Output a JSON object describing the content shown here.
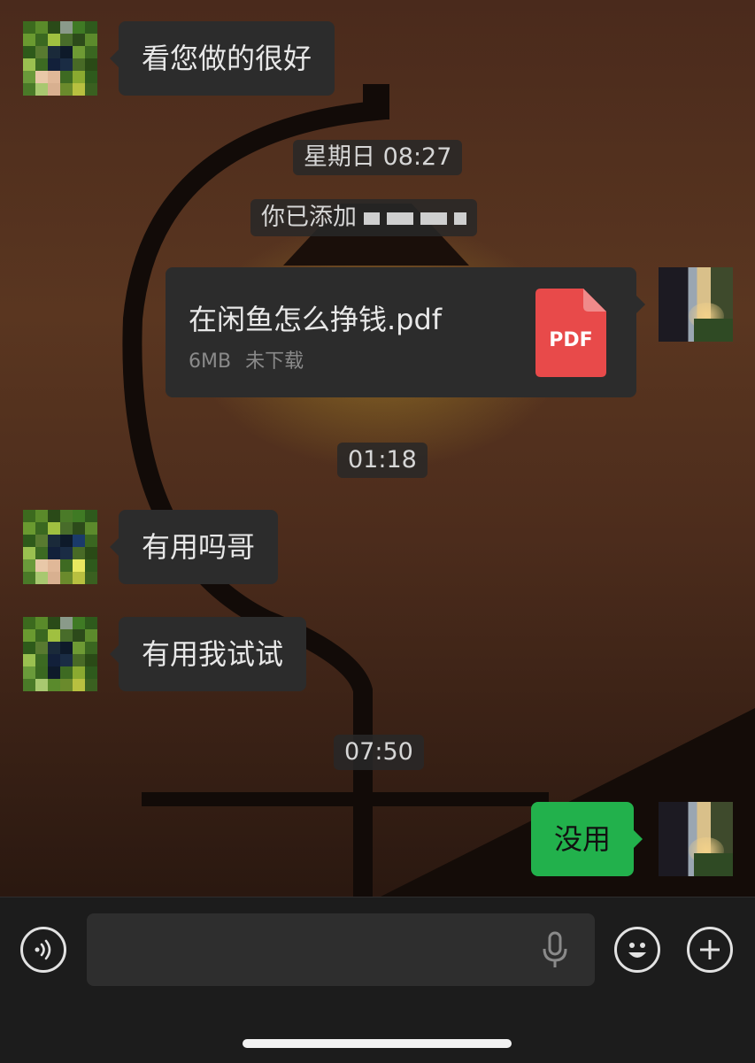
{
  "messages": [
    {
      "type": "incoming",
      "text": "看您做的很好"
    },
    {
      "type": "time",
      "text": "星期日 08:27"
    },
    {
      "type": "system",
      "text": "你已添加"
    },
    {
      "type": "file",
      "file_name": "在闲鱼怎么挣钱.pdf",
      "file_size": "6MB",
      "file_status": "未下载",
      "file_type": "PDF"
    },
    {
      "type": "time",
      "text": "01:18"
    },
    {
      "type": "incoming",
      "text": "有用吗哥"
    },
    {
      "type": "incoming",
      "text": "有用我试试"
    },
    {
      "type": "time",
      "text": "07:50"
    },
    {
      "type": "outgoing",
      "text": "没用"
    }
  ],
  "input_bar": {
    "placeholder": "",
    "voice_icon": "voice-toggle-icon",
    "mic_icon": "microphone-icon",
    "emoji_icon": "emoji-icon",
    "plus_icon": "plus-icon"
  },
  "colors": {
    "incoming_bubble": "#2c2c2c",
    "outgoing_bubble": "#22b14c",
    "pdf_icon": "#e84a4a",
    "input_bar_bg": "#1c1c1c"
  }
}
